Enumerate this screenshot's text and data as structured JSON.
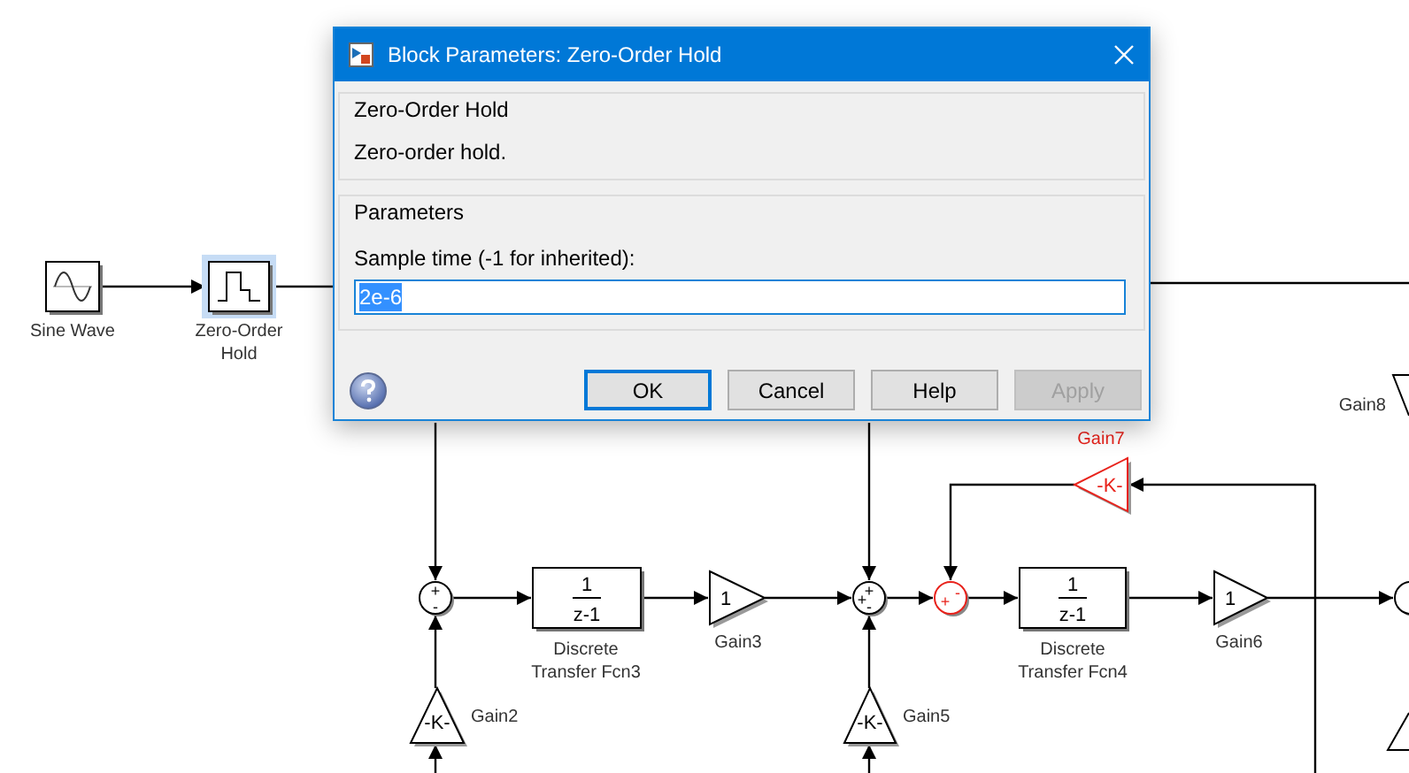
{
  "diagram": {
    "blocks": [
      {
        "kind": "sine",
        "label": [
          "Sine Wave"
        ],
        "selected": false,
        "highlighted": false
      },
      {
        "kind": "hold",
        "label": [
          "Zero-Order",
          "Hold"
        ],
        "selected": true,
        "highlighted": false
      },
      {
        "kind": "sum",
        "signs": [
          "+",
          "-"
        ],
        "selected": false,
        "highlighted": false
      },
      {
        "kind": "transfer",
        "num": "1",
        "den": "z-1",
        "label": [
          "Discrete",
          "Transfer Fcn3"
        ],
        "selected": false,
        "highlighted": false
      },
      {
        "kind": "gain",
        "text": "1",
        "label": [
          "Gain3"
        ],
        "selected": false,
        "highlighted": false
      },
      {
        "kind": "sum",
        "signs": [
          "+",
          "+",
          "-"
        ],
        "selected": false,
        "highlighted": false
      },
      {
        "kind": "gain",
        "text": "-K-",
        "label": [
          "Gain2"
        ],
        "selected": false,
        "highlighted": false
      },
      {
        "kind": "gain",
        "text": "-K-",
        "label": [
          "Gain5"
        ],
        "selected": false,
        "highlighted": false
      },
      {
        "kind": "sum",
        "signs": [
          "+",
          "-"
        ],
        "selected": false,
        "highlighted": true
      },
      {
        "kind": "gain",
        "text": "-K-",
        "label": [
          "Gain7"
        ],
        "selected": false,
        "highlighted": true
      },
      {
        "kind": "transfer",
        "num": "1",
        "den": "z-1",
        "label": [
          "Discrete",
          "Transfer Fcn4"
        ],
        "selected": false,
        "highlighted": false
      },
      {
        "kind": "gain",
        "text": "1",
        "label": [
          "Gain6"
        ],
        "selected": false,
        "highlighted": false
      },
      {
        "kind": "gain",
        "label": [
          "Gain8"
        ],
        "selected": false,
        "highlighted": false
      },
      {
        "kind": "sum",
        "selected": false,
        "highlighted": false
      },
      {
        "kind": "gain",
        "selected": false,
        "highlighted": false
      }
    ]
  },
  "dialog": {
    "title": "Block Parameters: Zero-Order Hold",
    "description_group": {
      "title": "Zero-Order Hold",
      "text": "Zero-order hold."
    },
    "parameters_group": {
      "title": "Parameters",
      "field_label": "Sample time (-1 for inherited):",
      "field_value": "2e-6",
      "value_selected": true
    },
    "buttons": [
      {
        "label": "OK",
        "focused": true,
        "disabled": false
      },
      {
        "label": "Cancel",
        "focused": false,
        "disabled": false
      },
      {
        "label": "Help",
        "focused": false,
        "disabled": false
      },
      {
        "label": "Apply",
        "focused": false,
        "disabled": true
      }
    ]
  }
}
